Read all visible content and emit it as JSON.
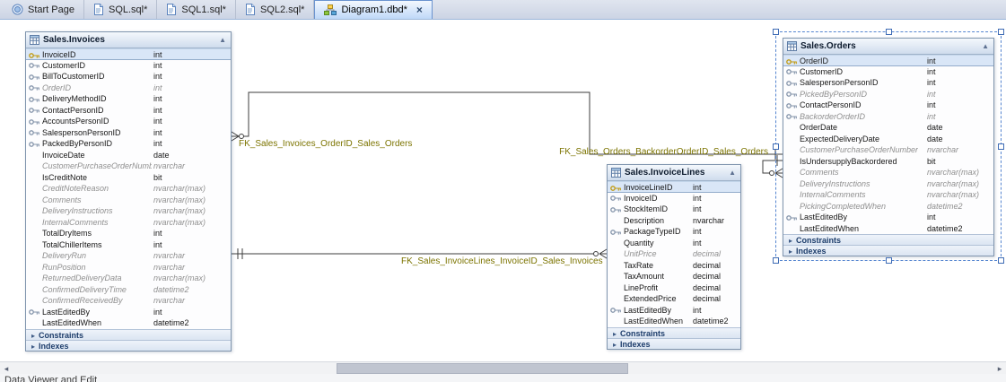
{
  "window": {
    "status_text": "Data Viewer and Edit"
  },
  "tabs": [
    {
      "label": "Start Page",
      "icon": "start-page-icon",
      "active": false,
      "closable": false
    },
    {
      "label": "SQL.sql*",
      "icon": "sql-file-icon",
      "active": false,
      "closable": false
    },
    {
      "label": "SQL1.sql*",
      "icon": "sql-file-icon",
      "active": false,
      "closable": false
    },
    {
      "label": "SQL2.sql*",
      "icon": "sql-file-icon",
      "active": false,
      "closable": false
    },
    {
      "label": "Diagram1.dbd*",
      "icon": "diagram-icon",
      "active": true,
      "closable": true
    }
  ],
  "diagram": {
    "tables": [
      {
        "name": "Sales.Invoices",
        "sections": [
          "Constraints",
          "Indexes"
        ],
        "columns": [
          {
            "name": "InvoiceID",
            "type": "int",
            "key": "pk"
          },
          {
            "name": "CustomerID",
            "type": "int",
            "key": "fk"
          },
          {
            "name": "BillToCustomerID",
            "type": "int",
            "key": "fk"
          },
          {
            "name": "OrderID",
            "type": "int",
            "key": "fk",
            "nullable": true
          },
          {
            "name": "DeliveryMethodID",
            "type": "int",
            "key": "fk"
          },
          {
            "name": "ContactPersonID",
            "type": "int",
            "key": "fk"
          },
          {
            "name": "AccountsPersonID",
            "type": "int",
            "key": "fk"
          },
          {
            "name": "SalespersonPersonID",
            "type": "int",
            "key": "fk"
          },
          {
            "name": "PackedByPersonID",
            "type": "int",
            "key": "fk"
          },
          {
            "name": "InvoiceDate",
            "type": "date"
          },
          {
            "name": "CustomerPurchaseOrderNumber",
            "type": "nvarchar",
            "nullable": true
          },
          {
            "name": "IsCreditNote",
            "type": "bit"
          },
          {
            "name": "CreditNoteReason",
            "type": "nvarchar(max)",
            "nullable": true
          },
          {
            "name": "Comments",
            "type": "nvarchar(max)",
            "nullable": true
          },
          {
            "name": "DeliveryInstructions",
            "type": "nvarchar(max)",
            "nullable": true
          },
          {
            "name": "InternalComments",
            "type": "nvarchar(max)",
            "nullable": true
          },
          {
            "name": "TotalDryItems",
            "type": "int"
          },
          {
            "name": "TotalChillerItems",
            "type": "int"
          },
          {
            "name": "DeliveryRun",
            "type": "nvarchar",
            "nullable": true
          },
          {
            "name": "RunPosition",
            "type": "nvarchar",
            "nullable": true
          },
          {
            "name": "ReturnedDeliveryData",
            "type": "nvarchar(max)",
            "nullable": true
          },
          {
            "name": "ConfirmedDeliveryTime",
            "type": "datetime2",
            "nullable": true
          },
          {
            "name": "ConfirmedReceivedBy",
            "type": "nvarchar",
            "nullable": true
          },
          {
            "name": "LastEditedBy",
            "type": "int",
            "key": "fk"
          },
          {
            "name": "LastEditedWhen",
            "type": "datetime2"
          }
        ]
      },
      {
        "name": "Sales.InvoiceLines",
        "sections": [
          "Constraints",
          "Indexes"
        ],
        "columns": [
          {
            "name": "InvoiceLineID",
            "type": "int",
            "key": "pk"
          },
          {
            "name": "InvoiceID",
            "type": "int",
            "key": "fk"
          },
          {
            "name": "StockItemID",
            "type": "int",
            "key": "fk"
          },
          {
            "name": "Description",
            "type": "nvarchar"
          },
          {
            "name": "PackageTypeID",
            "type": "int",
            "key": "fk"
          },
          {
            "name": "Quantity",
            "type": "int"
          },
          {
            "name": "UnitPrice",
            "type": "decimal",
            "nullable": true
          },
          {
            "name": "TaxRate",
            "type": "decimal"
          },
          {
            "name": "TaxAmount",
            "type": "decimal"
          },
          {
            "name": "LineProfit",
            "type": "decimal"
          },
          {
            "name": "ExtendedPrice",
            "type": "decimal"
          },
          {
            "name": "LastEditedBy",
            "type": "int",
            "key": "fk"
          },
          {
            "name": "LastEditedWhen",
            "type": "datetime2"
          }
        ]
      },
      {
        "name": "Sales.Orders",
        "sections": [
          "Constraints",
          "Indexes"
        ],
        "columns": [
          {
            "name": "OrderID",
            "type": "int",
            "key": "pk"
          },
          {
            "name": "CustomerID",
            "type": "int",
            "key": "fk"
          },
          {
            "name": "SalespersonPersonID",
            "type": "int",
            "key": "fk"
          },
          {
            "name": "PickedByPersonID",
            "type": "int",
            "key": "fk",
            "nullable": true
          },
          {
            "name": "ContactPersonID",
            "type": "int",
            "key": "fk"
          },
          {
            "name": "BackorderOrderID",
            "type": "int",
            "key": "fk",
            "nullable": true
          },
          {
            "name": "OrderDate",
            "type": "date"
          },
          {
            "name": "ExpectedDeliveryDate",
            "type": "date"
          },
          {
            "name": "CustomerPurchaseOrderNumber",
            "type": "nvarchar",
            "nullable": true
          },
          {
            "name": "IsUndersupplyBackordered",
            "type": "bit"
          },
          {
            "name": "Comments",
            "type": "nvarchar(max)",
            "nullable": true
          },
          {
            "name": "DeliveryInstructions",
            "type": "nvarchar(max)",
            "nullable": true
          },
          {
            "name": "InternalComments",
            "type": "nvarchar(max)",
            "nullable": true
          },
          {
            "name": "PickingCompletedWhen",
            "type": "datetime2",
            "nullable": true
          },
          {
            "name": "LastEditedBy",
            "type": "int",
            "key": "fk"
          },
          {
            "name": "LastEditedWhen",
            "type": "datetime2"
          }
        ]
      }
    ],
    "relationships": [
      {
        "name": "FK_Sales_Invoices_OrderID_Sales_Orders"
      },
      {
        "name": "FK_Sales_Orders_BackorderOrderID_Sales_Orders"
      },
      {
        "name": "FK_Sales_InvoiceLines_InvoiceID_Sales_Invoices"
      }
    ]
  }
}
